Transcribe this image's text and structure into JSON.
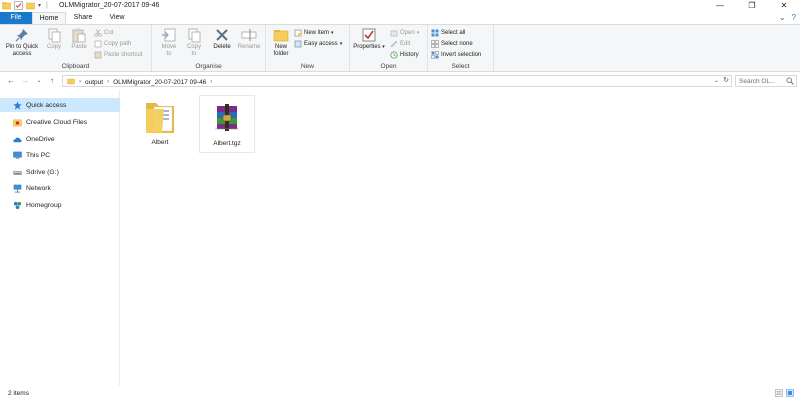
{
  "window": {
    "title": "OLMMigrator_20-07-2017 09-46",
    "minimize": "—",
    "maximize": "❐",
    "close": "✕"
  },
  "tabs": [
    {
      "label": "File"
    },
    {
      "label": "Home"
    },
    {
      "label": "Share"
    },
    {
      "label": "View"
    }
  ],
  "ribbon": {
    "clipboard": {
      "label": "Clipboard",
      "pin_line1": "Pin to Quick",
      "pin_line2": "access",
      "copy": "Copy",
      "paste": "Paste",
      "cut": "Cut",
      "copy_path": "Copy path",
      "paste_shortcut": "Paste shortcut"
    },
    "organise": {
      "label": "Organise",
      "move_line1": "Move",
      "move_line2": "to",
      "copy_line1": "Copy",
      "copy_line2": "to",
      "delete": "Delete",
      "rename": "Rename"
    },
    "new": {
      "label": "New",
      "folder_line1": "New",
      "folder_line2": "folder",
      "new_item": "New item",
      "easy_access": "Easy access"
    },
    "open": {
      "label": "Open",
      "properties": "Properties",
      "open": "Open",
      "edit": "Edit",
      "history": "History"
    },
    "select": {
      "label": "Select",
      "select_all": "Select all",
      "select_none": "Select none",
      "invert_selection": "Invert selection"
    }
  },
  "address": {
    "crumbs": [
      "output",
      "OLMMigrator_20-07-2017 09-46"
    ],
    "search_placeholder": "Search OL..."
  },
  "navpane": {
    "items": [
      {
        "label": "Quick access",
        "icon": "star-icon",
        "selected": true
      },
      {
        "label": "Creative Cloud Files",
        "icon": "creative-cloud-icon"
      },
      {
        "label": "OneDrive",
        "icon": "onedrive-cloud-icon"
      },
      {
        "label": "This PC",
        "icon": "computer-icon"
      },
      {
        "label": "Sdrive (G:)",
        "icon": "drive-icon"
      },
      {
        "label": "Network",
        "icon": "network-icon"
      },
      {
        "label": "Homegroup",
        "icon": "homegroup-icon"
      }
    ]
  },
  "files": [
    {
      "name": "Albert",
      "type": "folder"
    },
    {
      "name": "Albert.tgz",
      "type": "archive"
    }
  ],
  "status": {
    "item_count": "2 items"
  },
  "colors": {
    "file_tab": "#1979ca",
    "selection": "#cce8ff",
    "folder": "#f6cd5c"
  }
}
